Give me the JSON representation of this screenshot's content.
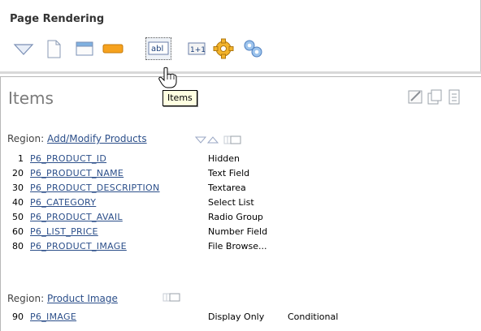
{
  "header": {
    "title": "Page Rendering"
  },
  "tooltip": "Items",
  "panel": {
    "title": "Items"
  },
  "regions": [
    {
      "label": "Region:",
      "name": "Add/Modify Products",
      "items": [
        {
          "seq": "1",
          "name": "P6_PRODUCT_ID",
          "type": "Hidden",
          "cond": ""
        },
        {
          "seq": "20",
          "name": "P6_PRODUCT_NAME",
          "type": "Text Field",
          "cond": ""
        },
        {
          "seq": "30",
          "name": "P6_PRODUCT_DESCRIPTION",
          "type": "Textarea",
          "cond": ""
        },
        {
          "seq": "40",
          "name": "P6_CATEGORY",
          "type": "Select List",
          "cond": ""
        },
        {
          "seq": "50",
          "name": "P6_PRODUCT_AVAIL",
          "type": "Radio Group",
          "cond": ""
        },
        {
          "seq": "60",
          "name": "P6_LIST_PRICE",
          "type": "Number Field",
          "cond": ""
        },
        {
          "seq": "80",
          "name": "P6_PRODUCT_IMAGE",
          "type": "File Browse...",
          "cond": ""
        }
      ]
    },
    {
      "label": "Region:",
      "name": "Product Image",
      "items": [
        {
          "seq": "90",
          "name": "P6_IMAGE",
          "type": "Display Only",
          "cond": "Conditional"
        }
      ]
    }
  ]
}
